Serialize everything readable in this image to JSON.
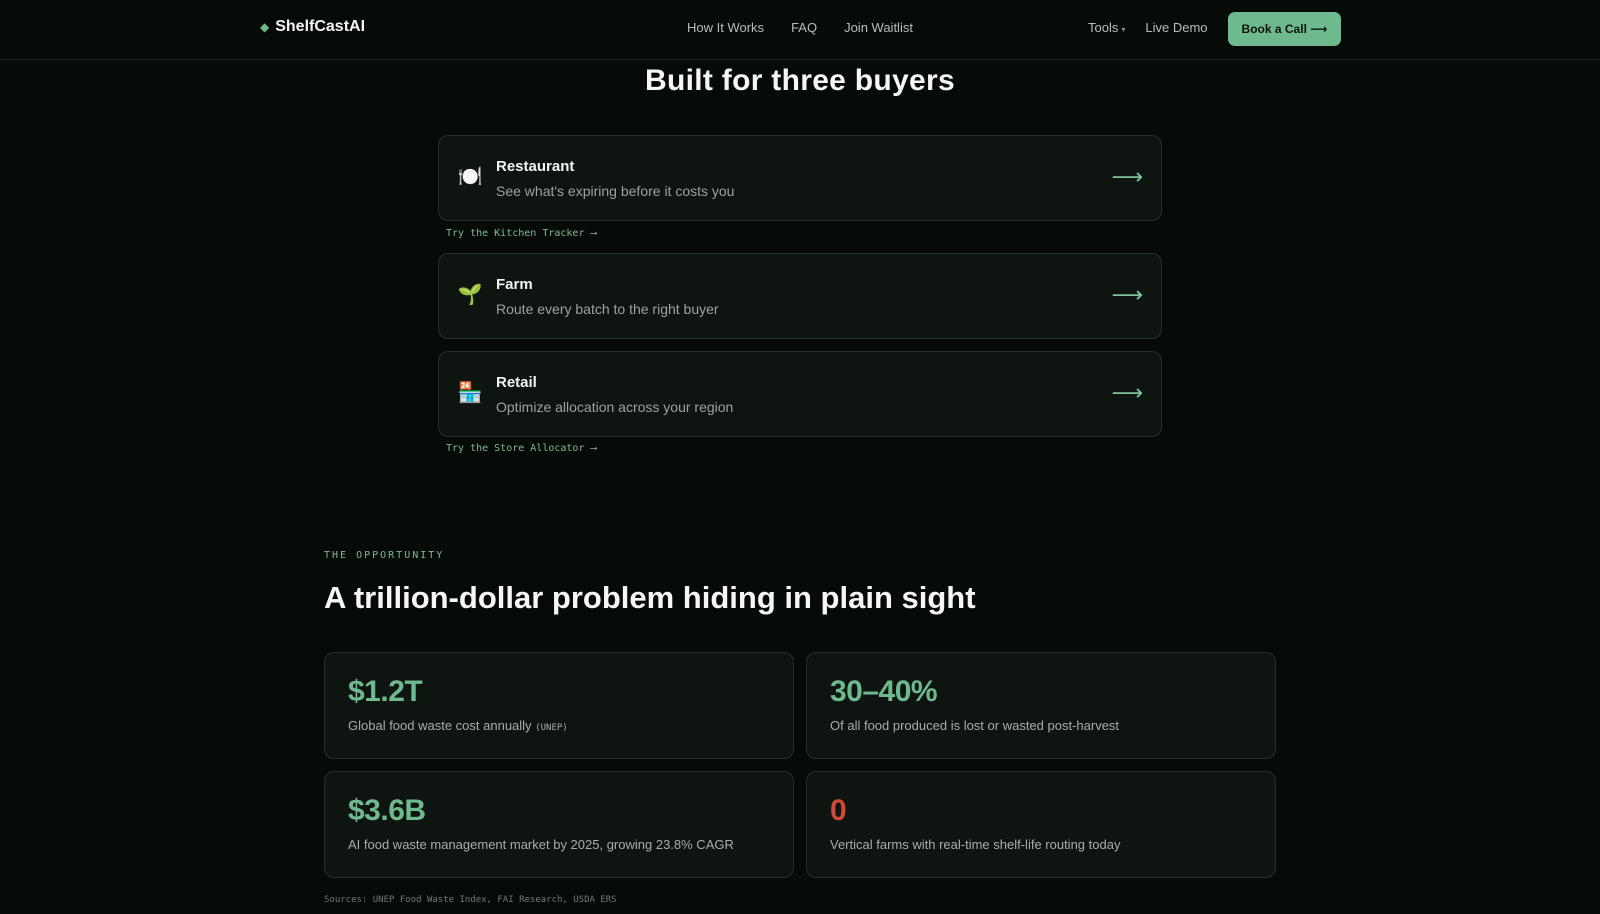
{
  "nav": {
    "logo_mark": "◆",
    "logo_text": "ShelfCastAI",
    "links": [
      "How It Works",
      "FAQ",
      "Join Waitlist"
    ],
    "tools_label": "Tools",
    "live_demo_label": "Live Demo",
    "cta_label": "Book a Call ⟶"
  },
  "buyers": {
    "title": "Built for three buyers",
    "items": [
      {
        "icon": "plate-icon",
        "glyph": "🍽️",
        "name": "Restaurant",
        "desc": "See what's expiring before it costs you",
        "arrow": "⟶"
      },
      {
        "icon": "seedling-icon",
        "glyph": "🌱",
        "name": "Farm",
        "desc": "Route every batch to the right buyer",
        "arrow": "⟶"
      },
      {
        "icon": "store-icon",
        "glyph": "🏪",
        "name": "Retail",
        "desc": "Optimize allocation across your region",
        "arrow": "⟶"
      }
    ],
    "kitchen_link": "Try the Kitchen Tracker ⟶",
    "store_link": "Try the Store Allocator ⟶"
  },
  "opportunity": {
    "eyebrow": "THE OPPORTUNITY",
    "title": "A trillion-dollar problem hiding in plain sight",
    "stats": [
      {
        "value": "$1.2T",
        "label": "Global food waste cost annually",
        "tag": "(UNEP)"
      },
      {
        "value": "30–40%",
        "label": "Of all food produced is lost or wasted post-harvest",
        "tag": ""
      },
      {
        "value": "$3.6B",
        "label": "AI food waste management market by 2025, growing 23.8% CAGR",
        "tag": ""
      },
      {
        "value": "0",
        "label": "Vertical farms with real-time shelf-life routing today",
        "tag": ""
      }
    ],
    "sources": "Sources: UNEP Food Waste Index, FAI Research, USDA ERS"
  },
  "colors": {
    "accent": "#6fb98f",
    "alert": "#d04a36",
    "background": "#070b08"
  }
}
